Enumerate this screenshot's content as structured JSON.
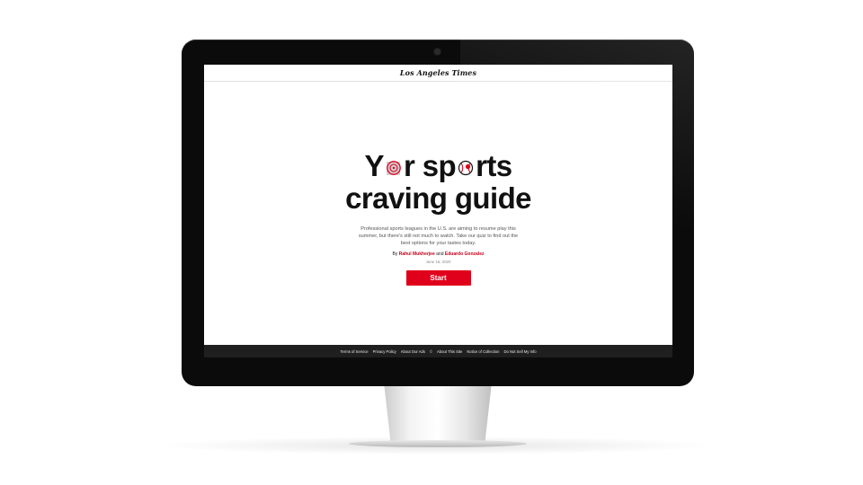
{
  "site": {
    "logo": "Los Angeles Times"
  },
  "article": {
    "title_line1_part1": "Y",
    "title_line1_part2": "r sp",
    "title_line1_part3": "rts",
    "title_line2": "craving guide",
    "dek": "Professional sports leagues in the U.S. are aiming to resume play this summer, but there's still not much to watch. Take our quiz to find out the best options for your tastes today.",
    "byline_prefix": "By",
    "author1": "Rahul Mukherjee",
    "byline_and": "and",
    "author2": "Eduardo Gonzalez",
    "date": "June 16, 2020",
    "start_label": "Start",
    "accent_color": "#e0001b",
    "ball_icons": [
      "target-ball-icon",
      "baseball-icon"
    ]
  },
  "footer": {
    "links": [
      "Terms of Service",
      "Privacy Policy",
      "About Our Ads",
      "©",
      "About This Site",
      "Notice of Collection",
      "Do Not Sell My Info"
    ]
  }
}
